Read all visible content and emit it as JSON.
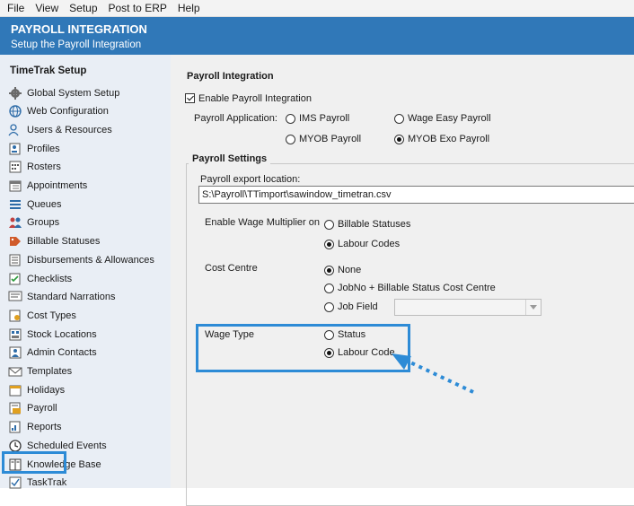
{
  "menu": [
    "File",
    "View",
    "Setup",
    "Post to ERP",
    "Help"
  ],
  "banner": {
    "title": "PAYROLL INTEGRATION",
    "subtitle": "Setup the Payroll Integration"
  },
  "sidebar": {
    "heading": "TimeTrak Setup",
    "items": [
      {
        "label": "Global System Setup",
        "icon": "gear-icon"
      },
      {
        "label": "Web Configuration",
        "icon": "globe-icon"
      },
      {
        "label": "Users & Resources",
        "icon": "users-icon"
      },
      {
        "label": "Profiles",
        "icon": "profile-icon"
      },
      {
        "label": "Rosters",
        "icon": "roster-icon"
      },
      {
        "label": "Appointments",
        "icon": "calendar-icon"
      },
      {
        "label": "Queues",
        "icon": "queue-icon"
      },
      {
        "label": "Groups",
        "icon": "groups-icon"
      },
      {
        "label": "Billable Statuses",
        "icon": "tag-icon"
      },
      {
        "label": "Disbursements & Allowances",
        "icon": "list-icon"
      },
      {
        "label": "Checklists",
        "icon": "checklist-icon"
      },
      {
        "label": "Standard Narrations",
        "icon": "narration-icon"
      },
      {
        "label": "Cost Types",
        "icon": "cost-icon"
      },
      {
        "label": "Stock Locations",
        "icon": "stock-icon"
      },
      {
        "label": "Admin Contacts",
        "icon": "contacts-icon"
      },
      {
        "label": "Templates",
        "icon": "envelope-icon"
      },
      {
        "label": "Holidays",
        "icon": "holiday-icon"
      },
      {
        "label": "Payroll",
        "icon": "payroll-icon",
        "selected": true
      },
      {
        "label": "Reports",
        "icon": "reports-icon"
      },
      {
        "label": "Scheduled Events",
        "icon": "clock-icon"
      },
      {
        "label": "Knowledge Base",
        "icon": "book-icon"
      },
      {
        "label": "TaskTrak",
        "icon": "tasktrak-icon"
      }
    ]
  },
  "main": {
    "heading": "Payroll Integration",
    "enable_label": "Enable Payroll Integration",
    "enable_checked": true,
    "application_label": "Payroll Application:",
    "applications": [
      {
        "label": "IMS Payroll",
        "checked": false
      },
      {
        "label": "Wage Easy Payroll",
        "checked": false
      },
      {
        "label": "MYOB Payroll",
        "checked": false
      },
      {
        "label": "MYOB Exo Payroll",
        "checked": true
      }
    ],
    "settings_title": "Payroll Settings",
    "export_label": "Payroll export location:",
    "export_value": "S:\\Payroll\\TTimport\\sawindow_timetran.csv",
    "wage_multiplier_label": "Enable Wage Multiplier on",
    "wage_multiplier_options": [
      {
        "label": "Billable Statuses",
        "checked": false
      },
      {
        "label": "Labour Codes",
        "checked": true
      }
    ],
    "cost_centre_label": "Cost Centre",
    "cost_centre_options": [
      {
        "label": "None",
        "checked": true
      },
      {
        "label": "JobNo + Billable Status Cost Centre",
        "checked": false
      },
      {
        "label": "Job Field",
        "checked": false
      }
    ],
    "job_field_value": "",
    "wage_type_label": "Wage Type",
    "wage_type_options": [
      {
        "label": "Status",
        "checked": false
      },
      {
        "label": "Labour Code",
        "checked": true
      }
    ]
  },
  "colors": {
    "banner": "#3078b8",
    "sidebar": "#e9eef5",
    "highlight": "#2d8bd6"
  }
}
